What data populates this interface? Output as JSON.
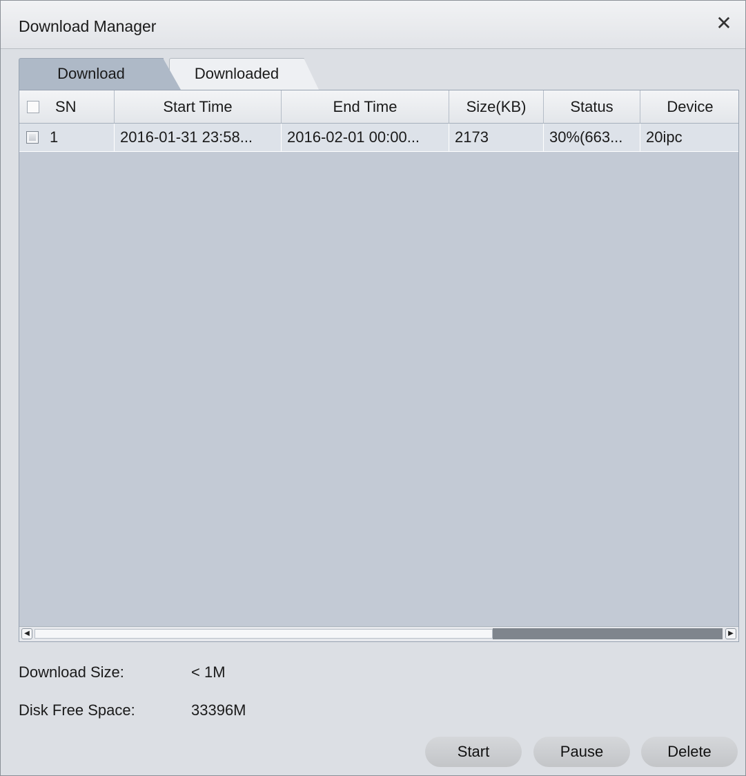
{
  "window": {
    "title": "Download Manager",
    "close_label": "✕"
  },
  "tabs": [
    {
      "label": "Download",
      "active": true
    },
    {
      "label": "Downloaded",
      "active": false
    }
  ],
  "table": {
    "columns": [
      "SN",
      "Start Time",
      "End Time",
      "Size(KB)",
      "Status",
      "Device"
    ],
    "rows": [
      {
        "checked": false,
        "sn": "1",
        "start_time": "2016-01-31 23:58...",
        "end_time": "2016-02-01 00:00...",
        "size": "2173",
        "status": "30%(663...",
        "device": "20ipc"
      }
    ]
  },
  "scrollbar": {
    "left_arrow": "◀",
    "right_arrow": "▶"
  },
  "info": {
    "download_size_label": "Download Size:",
    "download_size_value": "< 1M",
    "disk_free_label": "Disk Free Space:",
    "disk_free_value": "33396M"
  },
  "buttons": {
    "start": "Start",
    "pause": "Pause",
    "delete": "Delete"
  }
}
